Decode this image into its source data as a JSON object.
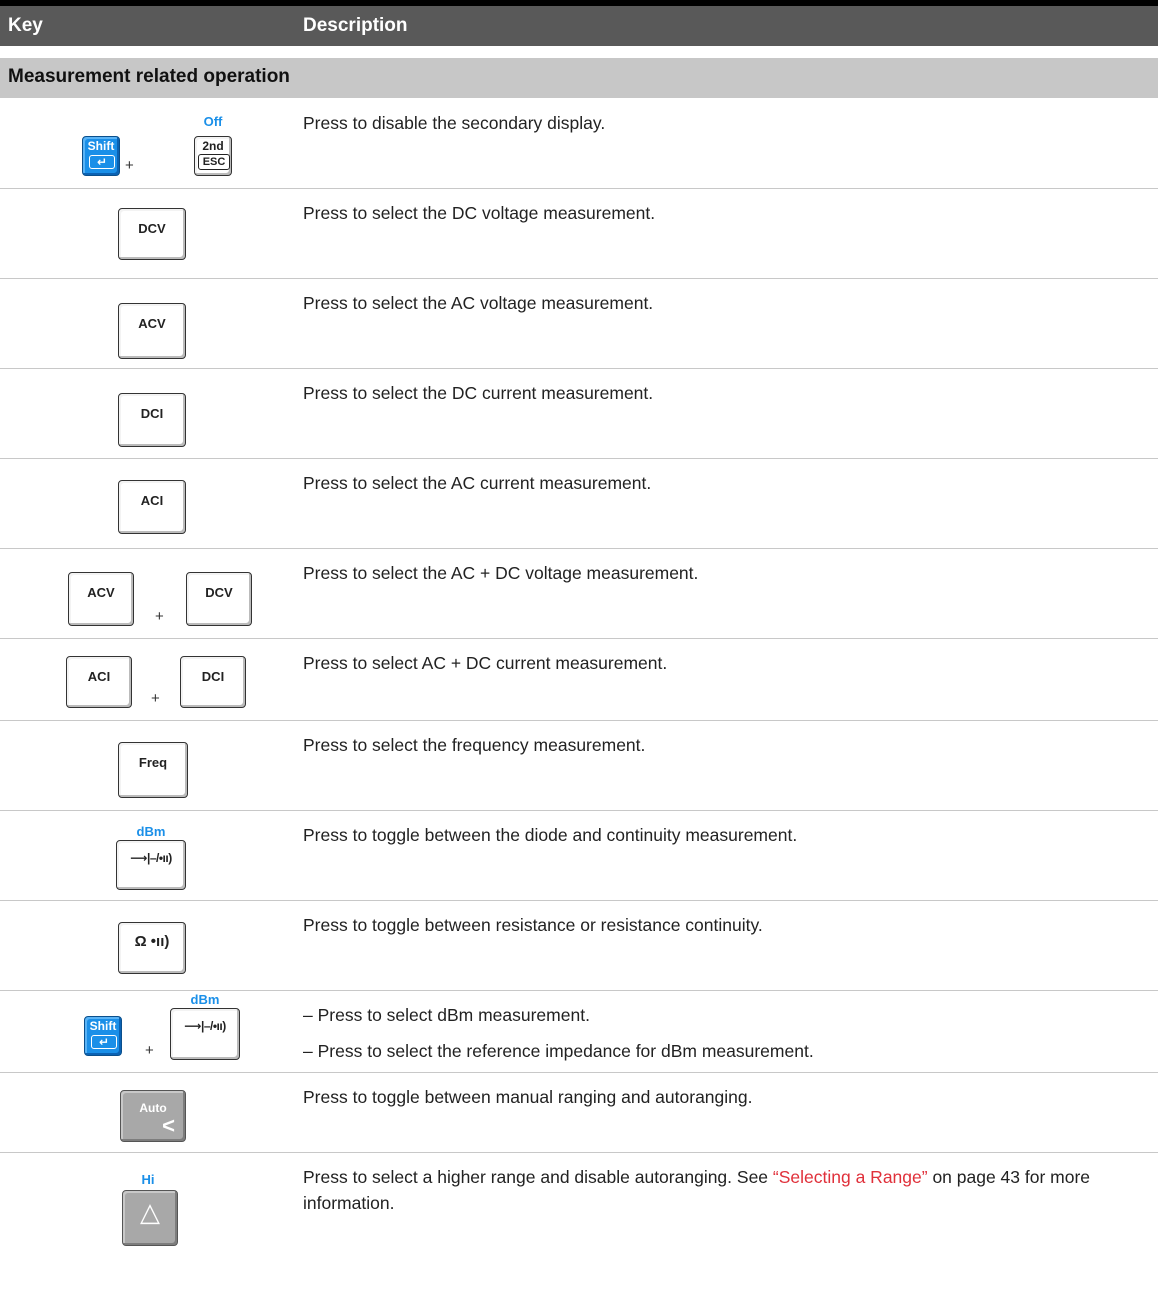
{
  "header": {
    "key_col": "Key",
    "desc_col": "Description"
  },
  "section": {
    "title": "Measurement related operation"
  },
  "keys": {
    "shift": "Shift",
    "enter_glyph": "↵",
    "second": "2nd",
    "esc": "ESC",
    "off": "Off",
    "dcv": "DCV",
    "acv": "ACV",
    "dci": "DCI",
    "aci": "ACI",
    "freq": "Freq",
    "dbm": "dBm",
    "diode": "⟶|–/•ıı)",
    "ohm": "Ω •ıı)",
    "auto": "Auto",
    "auto_arrow": "<",
    "hi": "Hi",
    "hi_triangle": "△",
    "plus": "+"
  },
  "rows": [
    {
      "desc": "Press to disable the secondary display."
    },
    {
      "desc": "Press to select the DC voltage measurement."
    },
    {
      "desc": "Press to select the AC voltage measurement."
    },
    {
      "desc": "Press to select the DC current measurement."
    },
    {
      "desc": "Press to select the AC current measurement."
    },
    {
      "desc": "Press to select the AC + DC voltage measurement."
    },
    {
      "desc": "Press to select AC + DC current measurement."
    },
    {
      "desc": "Press to select the frequency measurement."
    },
    {
      "desc": "Press to toggle between the diode and continuity measurement."
    },
    {
      "desc": "Press to toggle between resistance or resistance continuity."
    },
    {
      "items": [
        "Press to select dBm measurement.",
        "Press to select the reference impedance for dBm measurement."
      ]
    },
    {
      "desc": "Press to toggle between manual ranging and autoranging."
    },
    {
      "desc_before": "Press to select a higher range and disable autoranging. See ",
      "link": "“Selecting a Range”",
      "desc_after": " on page 43 for more information."
    }
  ]
}
